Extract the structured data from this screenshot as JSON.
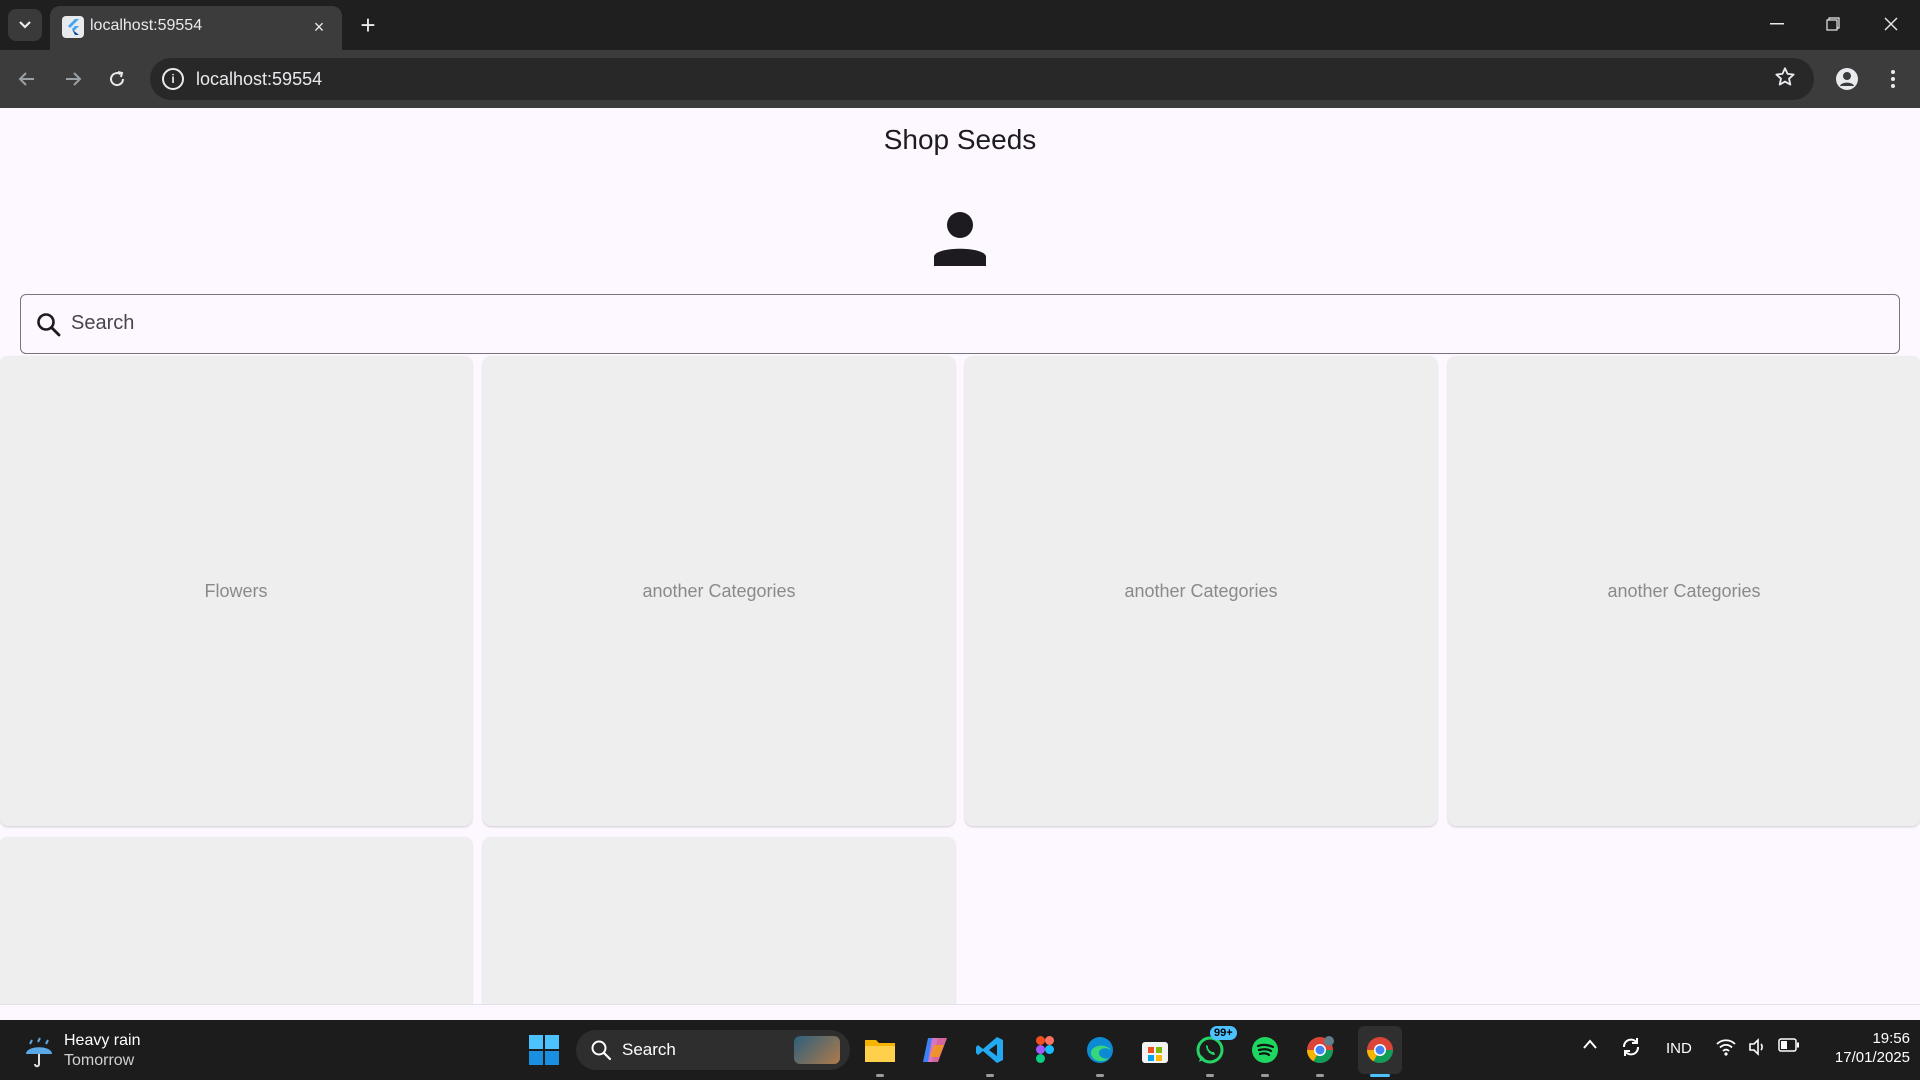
{
  "browser": {
    "tab_title": "localhost:59554",
    "url": "localhost:59554",
    "new_tab_symbol": "+",
    "close_symbol": "×"
  },
  "app": {
    "title": "Shop Seeds",
    "search_placeholder": "Search",
    "categories": [
      {
        "label": "Flowers"
      },
      {
        "label": "another Categories"
      },
      {
        "label": "another Categories"
      },
      {
        "label": "another Categories"
      },
      {
        "label": ""
      },
      {
        "label": ""
      }
    ],
    "background_color": "#fdf7ff",
    "card_color": "#eeeeee"
  },
  "taskbar": {
    "weather_main": "Heavy rain",
    "weather_sub": "Tomorrow",
    "search_label": "Search",
    "whatsapp_badge": "99+",
    "language": "IND",
    "time": "19:56",
    "date": "17/01/2025",
    "apps": [
      "file-explorer-icon",
      "copilot-icon",
      "vscode-icon",
      "figma-icon",
      "edge-icon",
      "store-icon",
      "whatsapp-icon",
      "spotify-icon",
      "chrome-profile-icon",
      "chrome-icon"
    ]
  }
}
